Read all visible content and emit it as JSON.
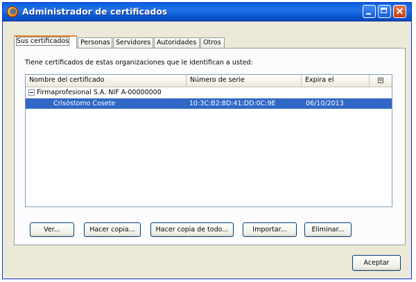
{
  "window": {
    "title": "Administrador de certificados"
  },
  "tabs": [
    {
      "label": "Sus certificados",
      "active": true
    },
    {
      "label": "Personas"
    },
    {
      "label": "Servidores"
    },
    {
      "label": "Autoridades"
    },
    {
      "label": "Otros"
    }
  ],
  "panel": {
    "intro": "Tiene certificados de estas organizaciones que le identifican a usted:",
    "columns": {
      "name": "Nombre del certificado",
      "serial": "Número de serie",
      "expires": "Expira el"
    },
    "organization": "Firmaprofesional S.A. NIF A-00000000",
    "certificates": [
      {
        "name": "Crisóstomo Cosete",
        "serial": "10:3C:B2:8D:41:DD:0C:9E",
        "expires": "06/10/2013",
        "selected": true
      }
    ]
  },
  "buttons": {
    "view": "Ver...",
    "backup": "Hacer copia...",
    "backup_all": "Hacer copia de todo...",
    "import": "Importar...",
    "delete": "Eliminar...",
    "ok": "Aceptar"
  },
  "icons": {
    "app": "firefox-icon",
    "column_picker": "column-picker-icon",
    "tree_toggle": "collapse-icon"
  }
}
